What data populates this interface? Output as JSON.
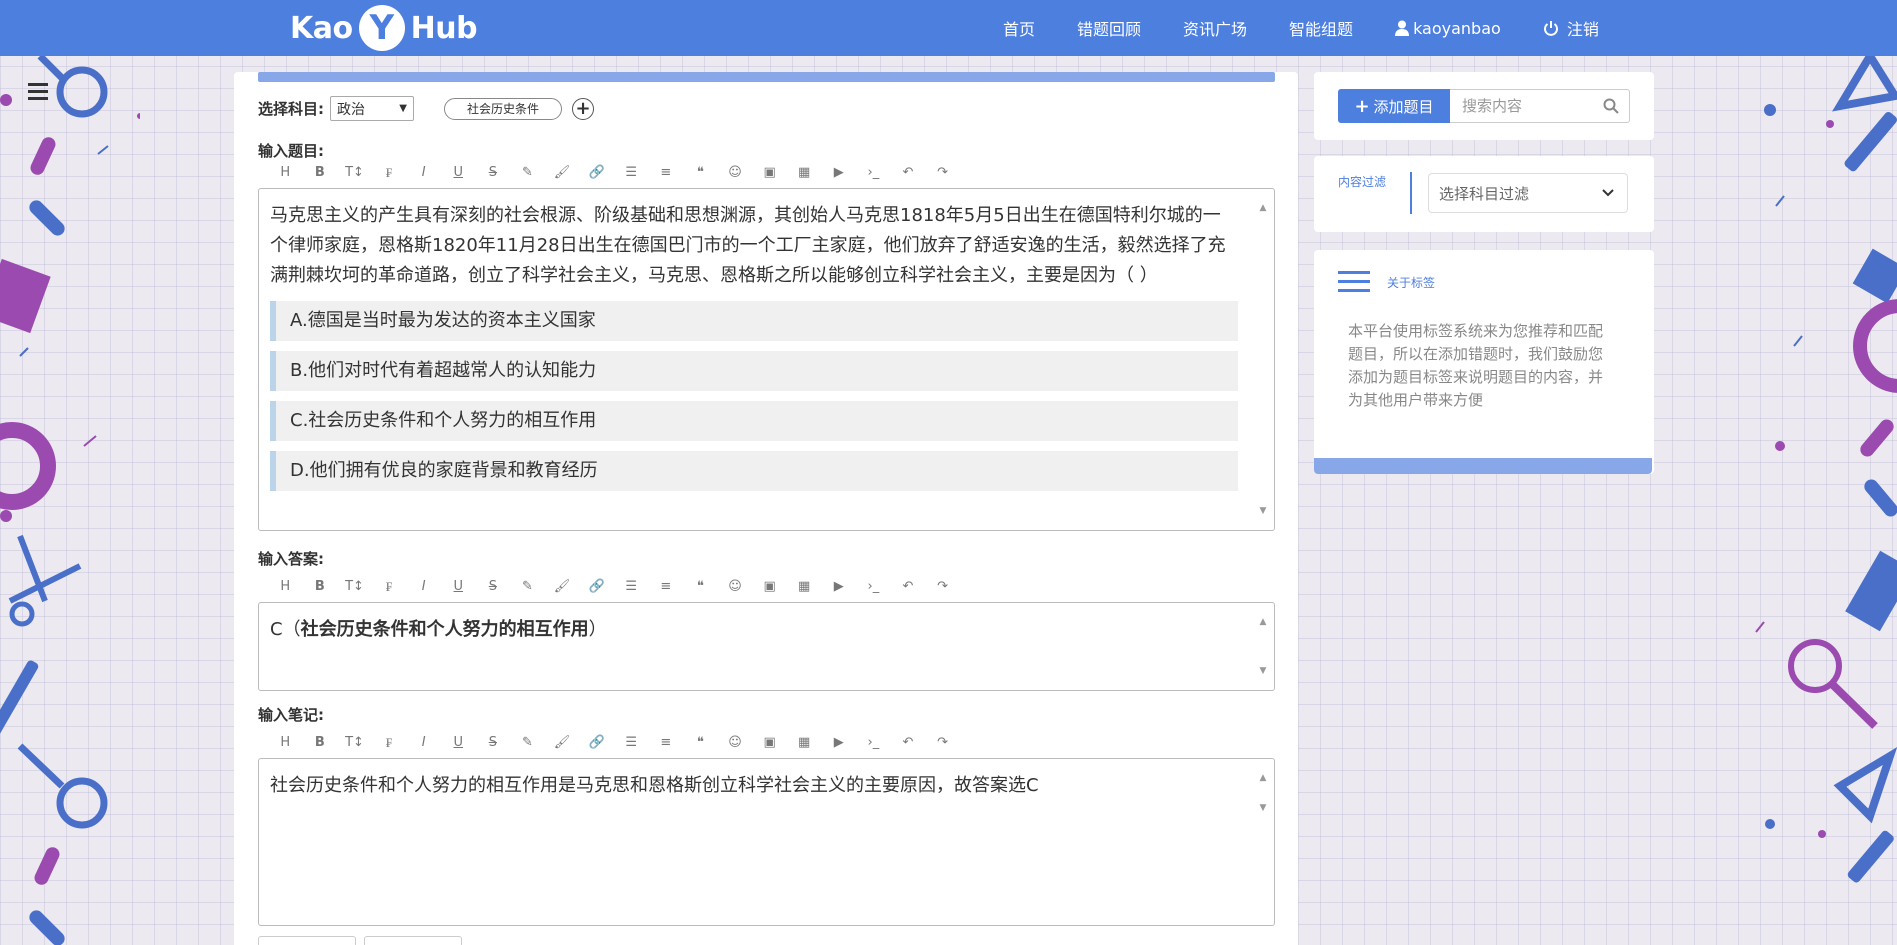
{
  "nav": {
    "logo_left": "Kao",
    "logo_mid": "Y",
    "logo_right": "Hub",
    "links": [
      "首页",
      "错题回顾",
      "资讯广场",
      "智能组题"
    ],
    "user": "kaoyanbao",
    "logout": "注销"
  },
  "subject": {
    "label": "选择科目:",
    "selected": "政治",
    "tag": "社会历史条件"
  },
  "question": {
    "label": "输入题目:",
    "stem": "马克思主义的产生具有深刻的社会根源、阶级基础和思想渊源，其创始人马克思1818年5月5日出生在德国特利尔城的一个律师家庭，恩格斯1820年11月28日出生在德国巴门市的一个工厂主家庭，他们放弃了舒适安逸的生活，毅然选择了充满荆棘坎坷的革命道路，创立了科学社会主义，马克思、恩格斯之所以能够创立科学社会主义，主要是因为（   ）",
    "options": [
      "A.德国是当时最为发达的资本主义国家",
      "B.他们对时代有着超越常人的认知能力",
      "C.社会历史条件和个人努力的相互作用",
      "D.他们拥有优良的家庭背景和教育经历"
    ]
  },
  "answer": {
    "label": "输入答案:",
    "prefix": "C（",
    "bold": "社会历史条件和个人努力的相互作用",
    "suffix": "）"
  },
  "notes": {
    "label": "输入笔记:",
    "text": "社会历史条件和个人努力的相互作用是马克思和恩格斯创立科学社会主义的主要原因，故答案选C"
  },
  "toolbar_icons": [
    "heading-icon",
    "bold-icon",
    "text-size-icon",
    "font-icon",
    "italic-icon",
    "underline-icon",
    "strikethrough-icon",
    "highlighter-icon",
    "brush-icon",
    "link-icon",
    "list-icon",
    "align-icon",
    "quote-icon",
    "emoji-icon",
    "image-icon",
    "table-icon",
    "video-icon",
    "code-icon",
    "undo-icon",
    "redo-icon"
  ],
  "sidebar": {
    "add_button": "添加题目",
    "search_placeholder": "搜索内容",
    "filter_label": "内容过滤",
    "filter_select": "选择科目过滤",
    "about_label": "关于标签",
    "about_text": "本平台使用标签系统来为您推荐和匹配题目，所以在添加错题时，我们鼓励您添加为题目标签来说明题目的内容，并为其他用户带来方便"
  },
  "colors": {
    "brand": "#4d7fdf",
    "accent_light": "#87a7e8",
    "deco_purple": "#9b4ab0",
    "deco_blue": "#4a6fc8"
  }
}
